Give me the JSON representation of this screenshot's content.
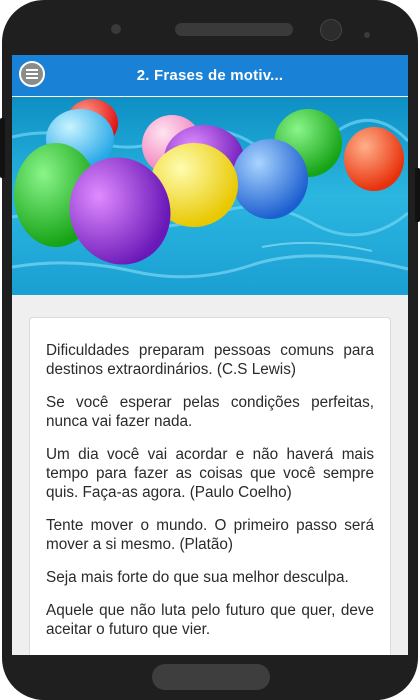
{
  "app_bar": {
    "menu_icon": "hamburger-menu-icon",
    "title": "2. Frases de motiv..."
  },
  "hero": {
    "description_icon": "balloons-in-pool-image",
    "colors": {
      "water": "#1aa8d8",
      "balloons": [
        "#ff2a2a",
        "#2ecc2e",
        "#9b30e0",
        "#ffe800",
        "#2f7fe8",
        "#ff4a1a",
        "#ff9ad0",
        "#4dd0f0"
      ]
    }
  },
  "quotes": [
    "Dificuldades preparam pessoas comuns para destinos extraordinários. (C.S Lewis)",
    "Se você esperar pelas condições perfeitas, nunca vai fazer nada.",
    "Um dia você vai acordar e não haverá mais tempo para fazer as coisas que você sempre quis. Faça-as agora. (Paulo Coelho)",
    "Tente mover o mundo. O primeiro passo será mover a si mesmo. (Platão)",
    "Seja mais forte do que sua melhor desculpa.",
    "Aquele que não luta pelo futuro que quer, deve aceitar o futuro que vier."
  ]
}
